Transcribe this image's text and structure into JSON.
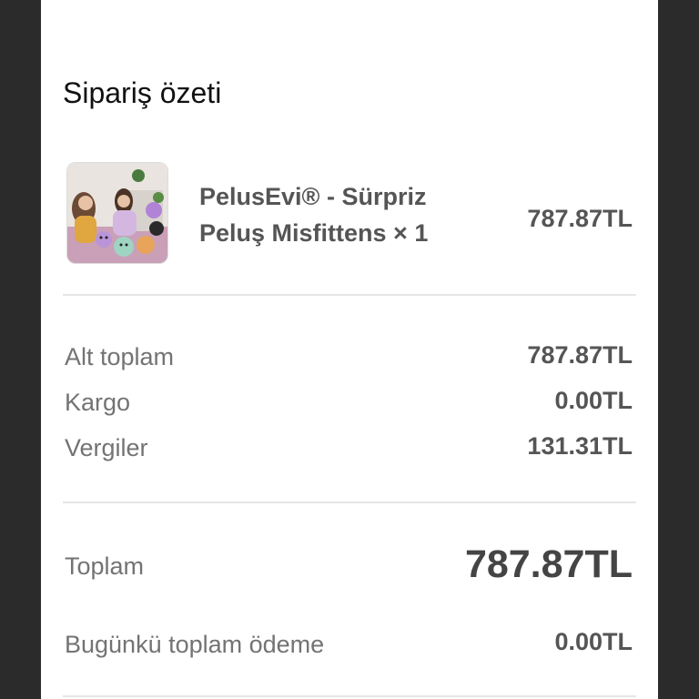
{
  "summary": {
    "title": "Sipariş özeti"
  },
  "product": {
    "name": "PelusEvi® - Sürpriz Peluş Misfittens × 1",
    "price": "787.87TL",
    "thumbnail_icon": "product-photo-plush-toys"
  },
  "breakdown": [
    {
      "label": "Alt toplam",
      "value": "787.87TL"
    },
    {
      "label": "Kargo",
      "value": "0.00TL"
    },
    {
      "label": "Vergiler",
      "value": "131.31TL"
    }
  ],
  "total": {
    "label": "Toplam",
    "value": "787.87TL"
  },
  "today_payment": {
    "label": "Bugünkü toplam ödeme",
    "value": "0.00TL"
  },
  "colors": {
    "background": "#2b2b2b",
    "panel": "#ffffff",
    "divider": "#e6e6e6",
    "muted_text": "#737373",
    "value_text": "#555555"
  }
}
